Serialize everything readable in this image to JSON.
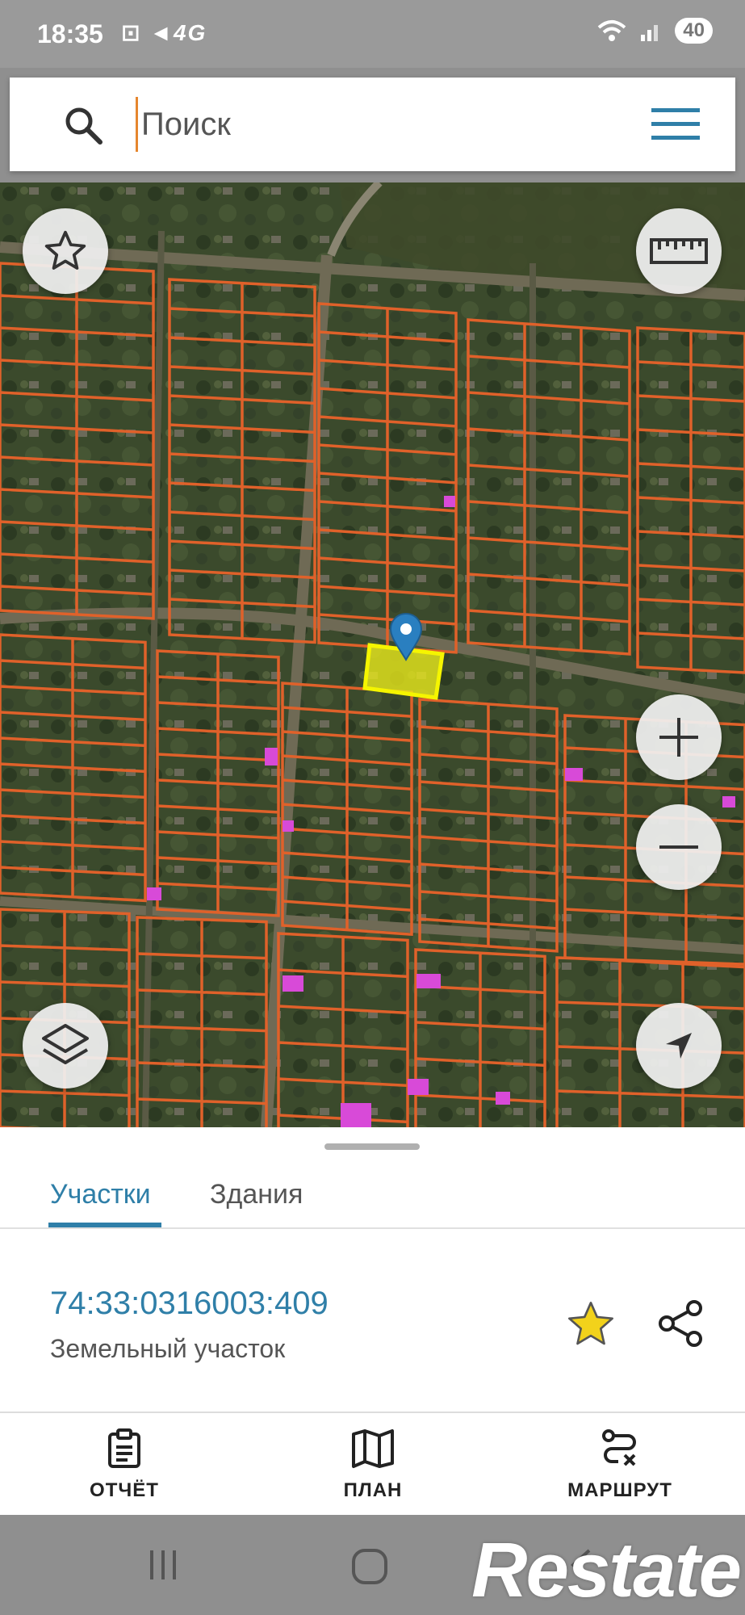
{
  "status_bar": {
    "time": "18:35",
    "left_icons_text": "⊡ ◄4G",
    "battery": "40"
  },
  "search": {
    "placeholder": "Поиск",
    "value": ""
  },
  "map": {
    "buttons": [
      "favorites-icon",
      "ruler-icon",
      "zoom-in-icon",
      "zoom-out-icon",
      "layers-icon",
      "location-icon"
    ],
    "colors": {
      "parcel_border": "#e0612a",
      "selected_parcel": "#e8e81c",
      "pin": "#2a7fc0"
    }
  },
  "sheet": {
    "tabs": [
      {
        "label": "Участки",
        "active": true
      },
      {
        "label": "Здания",
        "active": false
      }
    ],
    "parcel": {
      "number": "74:33:0316003:409",
      "type": "Земельный участок"
    },
    "actions": [
      {
        "label": "ОТЧЁТ",
        "icon": "report-icon"
      },
      {
        "label": "ПЛАН",
        "icon": "map-icon"
      },
      {
        "label": "МАРШРУТ",
        "icon": "route-icon"
      }
    ]
  },
  "watermark": "Restate",
  "colors": {
    "accent": "#2f7fa8",
    "star": "#f2d21b"
  }
}
